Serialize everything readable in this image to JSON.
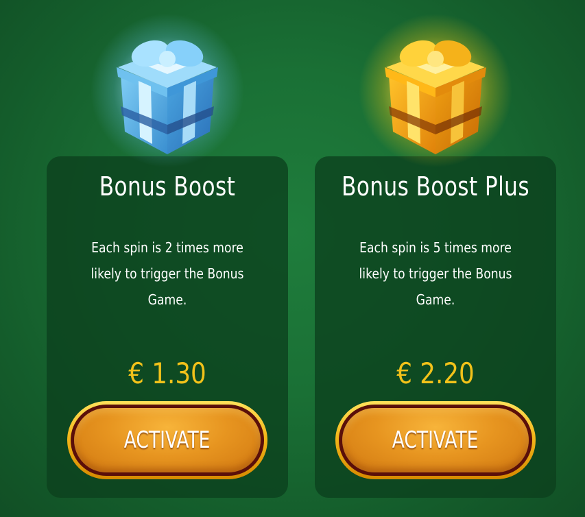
{
  "offers": [
    {
      "title": "Bonus Boost",
      "description": "Each spin is 2 times more likely to trigger the Bonus Game.",
      "price": "€ 1.30",
      "button_label": "ACTIVATE",
      "gift_icon": "blue-gift-box-icon",
      "gift_color": "#5ab4ec"
    },
    {
      "title": "Bonus Boost Plus",
      "description": "Each spin is 5 times more likely to trigger the Bonus Game.",
      "price": "€ 2.20",
      "button_label": "ACTIVATE",
      "gift_icon": "gold-gift-box-icon",
      "gift_color": "#f5a614"
    }
  ],
  "colors": {
    "background": "#1a7035",
    "card": "#0c401e",
    "price": "#f2c21a",
    "button_face": "#e79520",
    "button_rim": "#f3b81b"
  }
}
